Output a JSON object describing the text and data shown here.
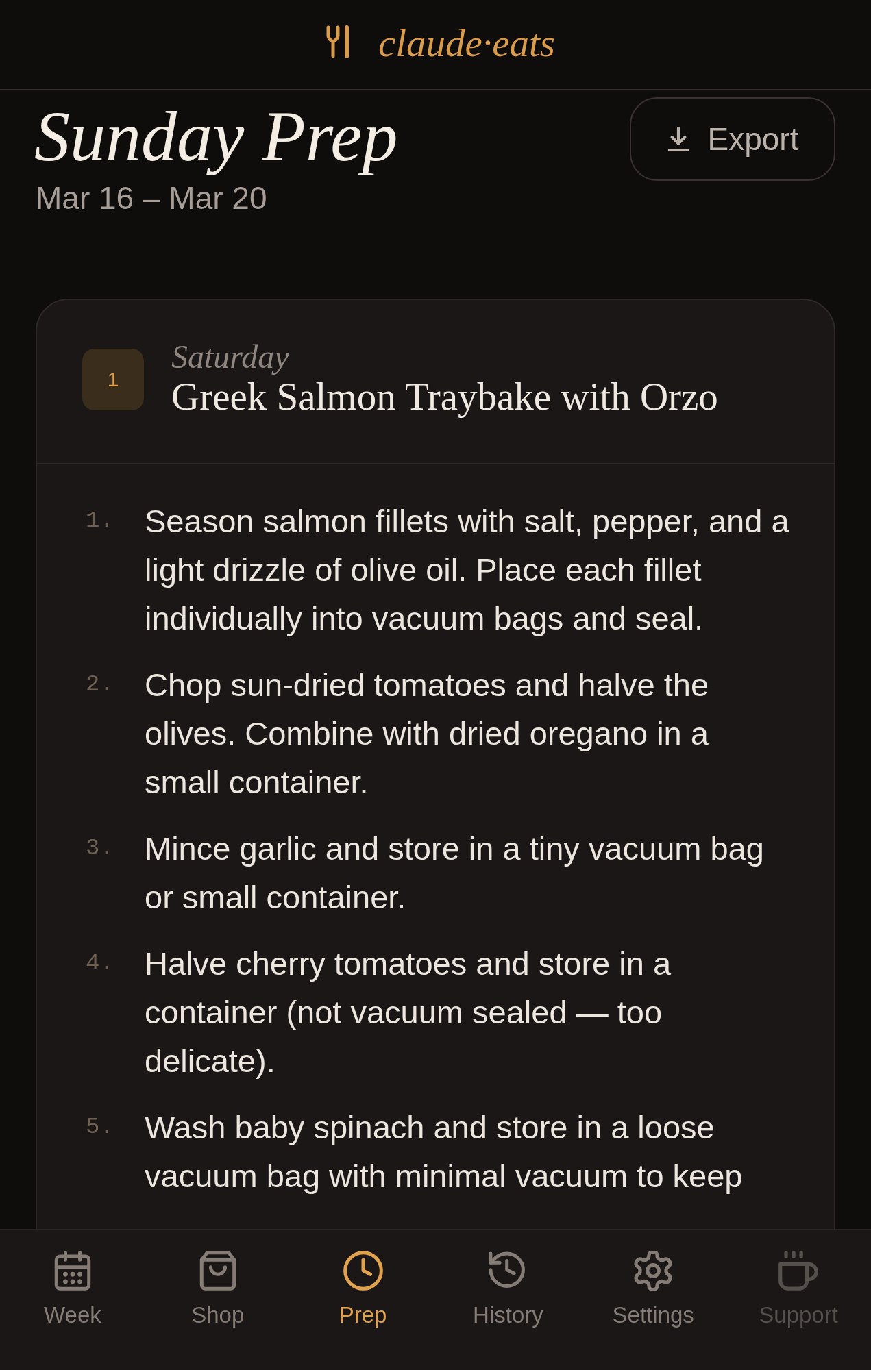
{
  "header": {
    "logo_text": "claude·eats"
  },
  "page": {
    "title": "Sunday Prep",
    "date_range": "Mar 16 – Mar 20",
    "export_button": "Export"
  },
  "prep_cards": [
    {
      "number": "1",
      "day": "Saturday",
      "recipe": "Greek Salmon Traybake with Orzo",
      "steps": [
        {
          "number": "1.",
          "text": "Season salmon fillets with salt, pepper, and a light drizzle of olive oil. Place each fillet individually into vacuum bags and seal."
        },
        {
          "number": "2.",
          "text": "Chop sun-dried tomatoes and halve the olives. Combine with dried oregano in a small container."
        },
        {
          "number": "3.",
          "text": "Mince garlic and store in a tiny vacuum bag or small container."
        },
        {
          "number": "4.",
          "text": "Halve cherry tomatoes and store in a container (not vacuum sealed — too delicate)."
        },
        {
          "number": "5.",
          "text": "Wash baby spinach and store in a loose vacuum bag with minimal vacuum to keep"
        }
      ]
    }
  ],
  "bottom_nav": [
    {
      "label": "Week",
      "kind": "calendar",
      "selected": false,
      "disabled": false
    },
    {
      "label": "Shop",
      "kind": "bag",
      "selected": false,
      "disabled": false
    },
    {
      "label": "Prep",
      "kind": "clock",
      "selected": true,
      "disabled": false
    },
    {
      "label": "History",
      "kind": "history",
      "selected": false,
      "disabled": false
    },
    {
      "label": "Settings",
      "kind": "gear",
      "selected": false,
      "disabled": false
    },
    {
      "label": "Support",
      "kind": "coffee",
      "selected": false,
      "disabled": true
    }
  ]
}
